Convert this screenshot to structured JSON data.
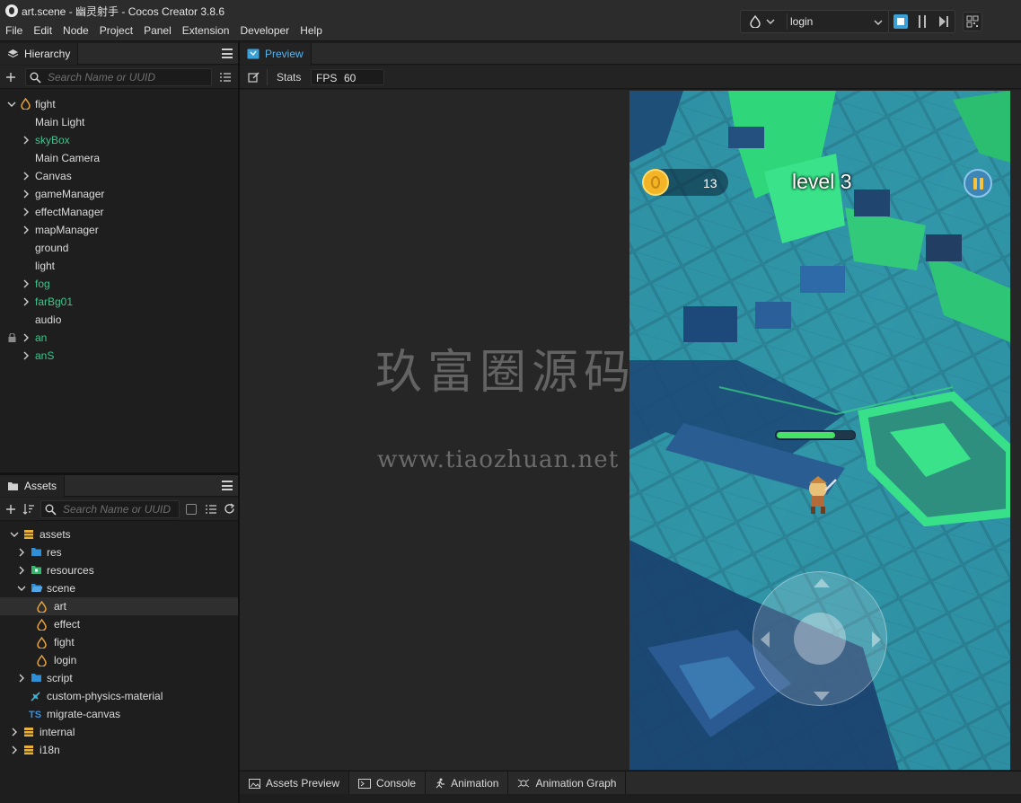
{
  "window": {
    "title": "art.scene - 幽灵射手 - Cocos Creator 3.8.6"
  },
  "menu": [
    "File",
    "Edit",
    "Node",
    "Project",
    "Panel",
    "Extension",
    "Developer",
    "Help"
  ],
  "toolbar": {
    "scene_select_value": "login"
  },
  "hierarchy": {
    "tab_label": "Hierarchy",
    "search_placeholder": "Search Name or UUID",
    "root": "fight",
    "items": [
      {
        "label": "Main Light",
        "expandable": false,
        "green": false
      },
      {
        "label": "skyBox",
        "expandable": true,
        "green": true
      },
      {
        "label": "Main Camera",
        "expandable": false,
        "green": false
      },
      {
        "label": "Canvas",
        "expandable": true,
        "green": false
      },
      {
        "label": "gameManager",
        "expandable": true,
        "green": false
      },
      {
        "label": "effectManager",
        "expandable": true,
        "green": false
      },
      {
        "label": "mapManager",
        "expandable": true,
        "green": false
      },
      {
        "label": "ground",
        "expandable": false,
        "green": false
      },
      {
        "label": "light",
        "expandable": false,
        "green": false
      },
      {
        "label": "fog",
        "expandable": true,
        "green": true
      },
      {
        "label": "farBg01",
        "expandable": true,
        "green": true
      },
      {
        "label": "audio",
        "expandable": false,
        "green": false
      },
      {
        "label": "an",
        "expandable": true,
        "green": true,
        "locked": true
      },
      {
        "label": "anS",
        "expandable": true,
        "green": true
      }
    ]
  },
  "assets": {
    "tab_label": "Assets",
    "search_placeholder": "Search Name or UUID",
    "root": "assets",
    "items": [
      {
        "label": "res",
        "type": "folder"
      },
      {
        "label": "resources",
        "type": "folder-res"
      },
      {
        "label": "scene",
        "type": "folder-open"
      },
      {
        "label": "art",
        "type": "scene"
      },
      {
        "label": "effect",
        "type": "scene"
      },
      {
        "label": "fight",
        "type": "scene"
      },
      {
        "label": "login",
        "type": "scene"
      },
      {
        "label": "script",
        "type": "folder"
      },
      {
        "label": "custom-physics-material",
        "type": "physics"
      },
      {
        "label": "migrate-canvas",
        "type": "ts"
      },
      {
        "label": "internal",
        "type": "db"
      },
      {
        "label": "i18n",
        "type": "db"
      }
    ]
  },
  "preview": {
    "tab_label": "Preview",
    "stats_label": "Stats",
    "fps_label": "FPS",
    "fps_value": "60"
  },
  "game": {
    "coins": "13",
    "level": "level 3",
    "health_fraction": 0.75
  },
  "watermark": {
    "cn": "玖富圈源码",
    "url": "www.tiaozhuan.net"
  },
  "bottom_tabs": [
    "Assets Preview",
    "Console",
    "Animation",
    "Animation Graph"
  ],
  "colors": {
    "accent": "#3aa0d8",
    "green_node": "#3fc48d",
    "scene_icon": "#e7a33a",
    "folder": "#2f8fd6"
  }
}
